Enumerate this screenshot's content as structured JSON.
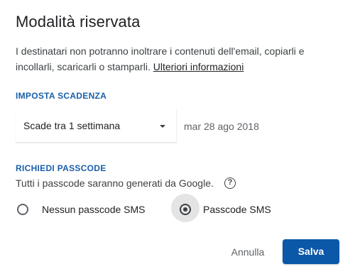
{
  "dialog": {
    "title": "Modalità riservata",
    "description": "I destinatari non potranno inoltrare i contenuti dell'email, copiarli e incollarli, scaricarli o stamparli.",
    "learn_more": "Ulteriori informazioni"
  },
  "expiry": {
    "section_label": "IMPOSTA SCADENZA",
    "selected_option": "Scade tra 1 settimana",
    "date": "mar 28 ago 2018"
  },
  "passcode": {
    "section_label": "RICHIEDI PASSCODE",
    "info": "Tutti i passcode saranno generati da Google.",
    "help_icon": "help-circle-icon",
    "help_glyph": "?",
    "options": [
      {
        "label": "Nessun passcode SMS",
        "checked": false
      },
      {
        "label": "Passcode SMS",
        "checked": true
      }
    ]
  },
  "actions": {
    "cancel_label": "Annulla",
    "save_label": "Salva"
  },
  "colors": {
    "accent": "#0b57a8",
    "section_label": "#1a5fa8"
  }
}
